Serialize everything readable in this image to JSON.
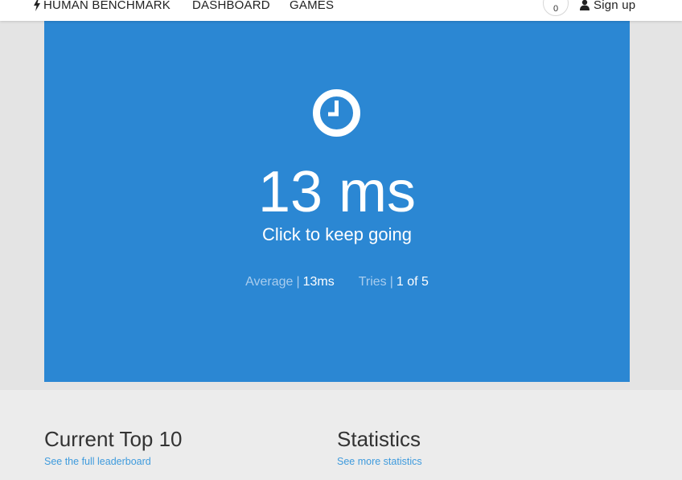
{
  "nav": {
    "brand": "HUMAN BENCHMARK",
    "dashboard": "DASHBOARD",
    "games": "GAMES",
    "counter": "0",
    "signup": "Sign up"
  },
  "game": {
    "result": "13 ms",
    "subtitle": "Click to keep going",
    "average_label": "Average",
    "average_value": "13ms",
    "tries_label": "Tries",
    "tries_value": "1 of 5",
    "separator": "|",
    "background_color": "#2b87d3",
    "icon": "clock-icon"
  },
  "sections": {
    "top10_title": "Current Top 10",
    "top10_link": "See the full leaderboard",
    "stats_title": "Statistics",
    "stats_link": "See more statistics"
  },
  "colors": {
    "accent_blue": "#2b87d3",
    "link_blue": "#3f9bdd"
  }
}
